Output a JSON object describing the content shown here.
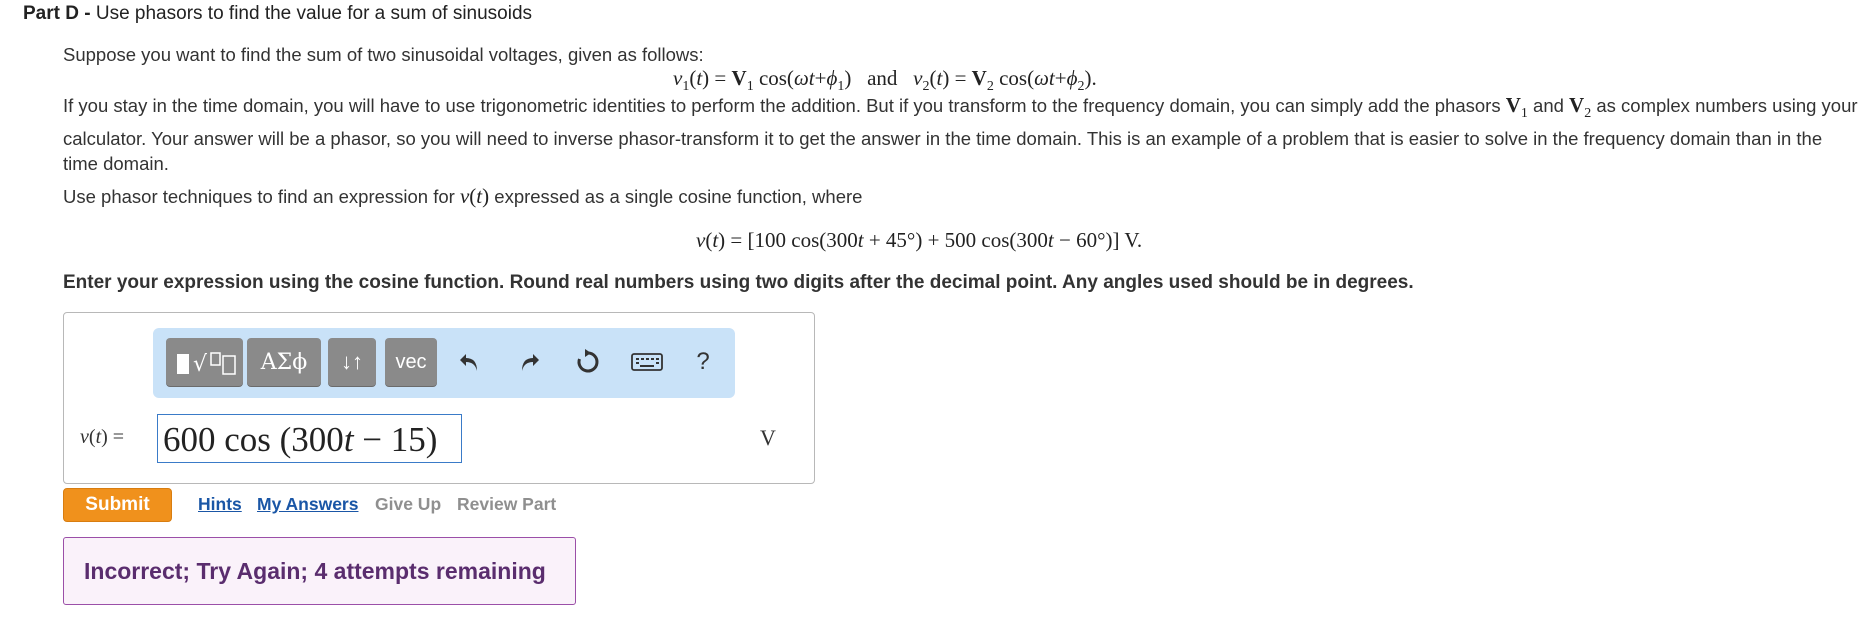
{
  "part": {
    "label": "Part D -",
    "title": "Use phasors to find the value for a sum of sinusoids"
  },
  "intro": "Suppose you want to find the sum of two sinusoidal voltages, given as follows:",
  "equation1": {
    "v1": "v1(t) = V1 cos(ωt+ϕ1)",
    "and": "and",
    "v2": "v2(t) = V2 cos(ωt+ϕ2)."
  },
  "paragraph": {
    "part1": "If you stay in the time domain, you will have to use trigonometric identities to perform the addition. But if you transform to the frequency domain, you can simply add the phasors",
    "and": "and",
    "part2": "as complex numbers using your calculator. Your answer will be a phasor, so you will need to inverse phasor-transform it to get the answer in the time domain. This is an example of a problem that is easier to solve in the frequency domain than in the time domain."
  },
  "question": {
    "prefix": "Use phasor techniques to find an expression for",
    "suffix": "expressed as a single cosine function, where"
  },
  "equation2": "v(t) = [100 cos(300t + 45°) + 500 cos(300t − 60°)] V.",
  "instruction": "Enter your expression using the cosine function. Round real numbers using two digits after the decimal point. Any angles used should be in degrees.",
  "toolbar": {
    "templates_label": "▮√▯",
    "greek_label": "ΑΣϕ",
    "arrows_label": "↓↑",
    "vec_label": "vec",
    "help_label": "?"
  },
  "answer": {
    "label": "v(t) =",
    "value_coef": "600 cos (300",
    "value_t": "t",
    "value_rest": " − 15)",
    "unit": "V"
  },
  "actions": {
    "submit": "Submit",
    "hints": "Hints",
    "my_answers": "My Answers",
    "give_up": "Give Up",
    "review_part": "Review Part"
  },
  "feedback": "Incorrect; Try Again; 4 attempts remaining"
}
